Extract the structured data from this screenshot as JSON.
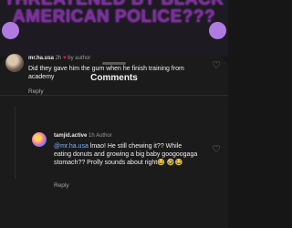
{
  "video": {
    "headline": "THREATENED BY BLACK AMERICAN POLICE???"
  },
  "sheet": {
    "title": "Comments"
  },
  "comments": [
    {
      "user": "mr.ha.usa",
      "time": "2h",
      "liked_by_author": "by author",
      "text": "Did they gave him the gum when he finish training from academy",
      "reply_label": "Reply"
    },
    {
      "user": "tamjid.active",
      "time": "1h",
      "author_label": "Author",
      "mention": "@mr.ha.usa",
      "text": " lmao! He still chewing it?? While eating donuts and growing a big baby googoogaga stomach?? Prolly sounds about right😂 🤣😂",
      "reply_label": "Reply"
    }
  ],
  "colors": {
    "accent_link": "#7fb0ff",
    "heart": "#e0245e",
    "headline": "#7a2f9a"
  },
  "icons": {
    "like": "heart-icon",
    "liked_by_author": "heart-icon"
  }
}
